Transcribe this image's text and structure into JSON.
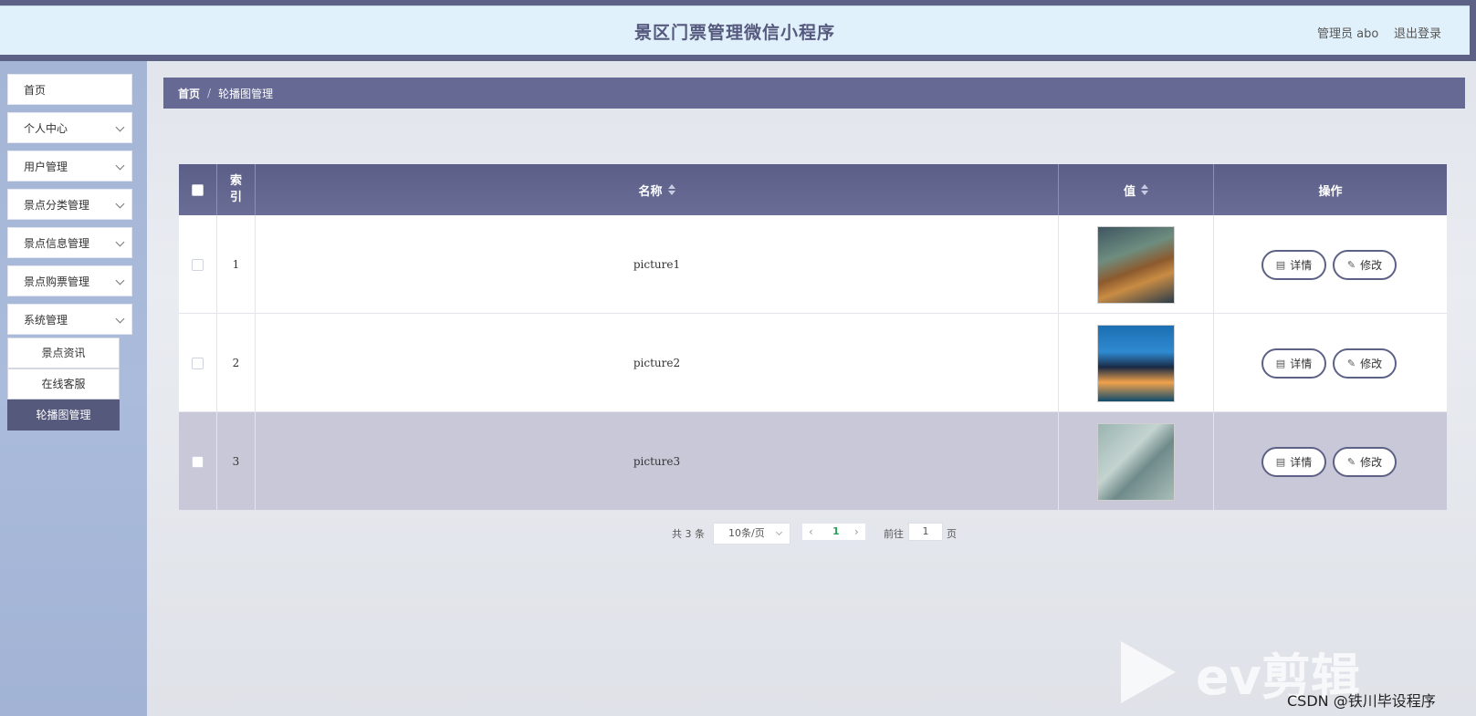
{
  "header": {
    "title": "景区门票管理微信小程序",
    "user": "管理员 abo",
    "logout": "退出登录"
  },
  "sidebar": {
    "items": [
      {
        "label": "首页"
      },
      {
        "label": "个人中心"
      },
      {
        "label": "用户管理"
      },
      {
        "label": "景点分类管理"
      },
      {
        "label": "景点信息管理"
      },
      {
        "label": "景点购票管理"
      },
      {
        "label": "系统管理"
      }
    ],
    "sub_items": [
      {
        "label": "景点资讯"
      },
      {
        "label": "在线客服"
      },
      {
        "label": "轮播图管理",
        "active": true
      }
    ]
  },
  "breadcrumb": {
    "home": "首页",
    "separator": "/",
    "current": "轮播图管理"
  },
  "table": {
    "headers": {
      "index": "索引",
      "name": "名称",
      "value": "值",
      "actions": "操作"
    },
    "rows": [
      {
        "index": "1",
        "name": "picture1",
        "detail": "详情",
        "edit": "修改"
      },
      {
        "index": "2",
        "name": "picture2",
        "detail": "详情",
        "edit": "修改"
      },
      {
        "index": "3",
        "name": "picture3",
        "detail": "详情",
        "edit": "修改"
      }
    ]
  },
  "pagination": {
    "total": "共 3 条",
    "page_size": "10条/页",
    "current_page": "1",
    "goto_label": "前往",
    "goto_value": "1",
    "page_label": "页"
  },
  "watermark": {
    "ev": "ev剪辑",
    "csdn": "CSDN @铁川毕设程序"
  },
  "colors": {
    "accent": "#5d6186",
    "header_bg": "#e1f1fb",
    "sidebar_bg": "#a4b5d6",
    "row_highlight": "#c9c8d8"
  }
}
